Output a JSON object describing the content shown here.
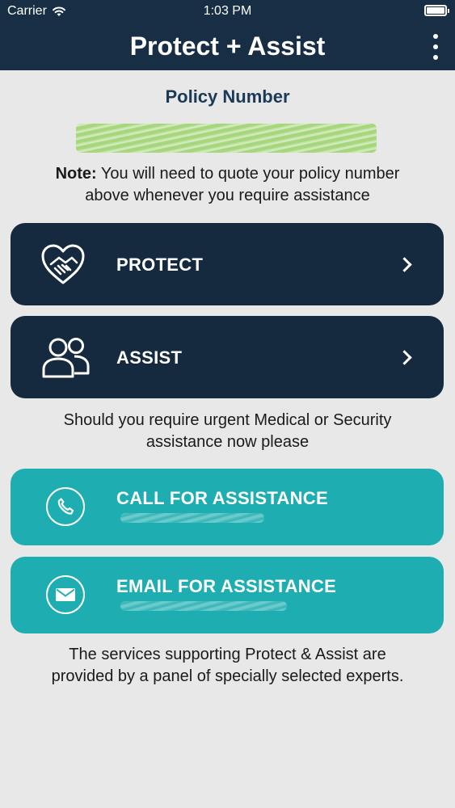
{
  "status_bar": {
    "carrier": "Carrier",
    "time": "1:03 PM",
    "wifi_icon": "wifi-icon",
    "battery_icon": "battery-icon"
  },
  "header": {
    "title": "Protect + Assist",
    "menu_icon": "more-vertical-icon"
  },
  "policy": {
    "title": "Policy Number",
    "note_label": "Note:",
    "note_line1": " You will need to quote your policy number",
    "note_line2": "above whenever you require assistance"
  },
  "menu": {
    "protect": {
      "label": "PROTECT",
      "icon": "heart-handshake-icon"
    },
    "assist": {
      "label": "ASSIST",
      "icon": "users-icon"
    }
  },
  "urgent": {
    "line1": "Should you require urgent Medical or Security",
    "line2": "assistance now please"
  },
  "actions": {
    "call": {
      "label": "CALL FOR ASSISTANCE",
      "icon": "phone-icon"
    },
    "email": {
      "label": "EMAIL FOR ASSISTANCE",
      "icon": "envelope-icon"
    }
  },
  "footer": {
    "line1": "The services supporting Protect & Assist are",
    "line2": "provided by a panel of specially selected experts."
  },
  "colors": {
    "header_bg": "#172e45",
    "dark_card": "#15293f",
    "teal_card": "#1eadb0",
    "page_bg": "#e8e8e8",
    "policy_title": "#1a3a57"
  }
}
